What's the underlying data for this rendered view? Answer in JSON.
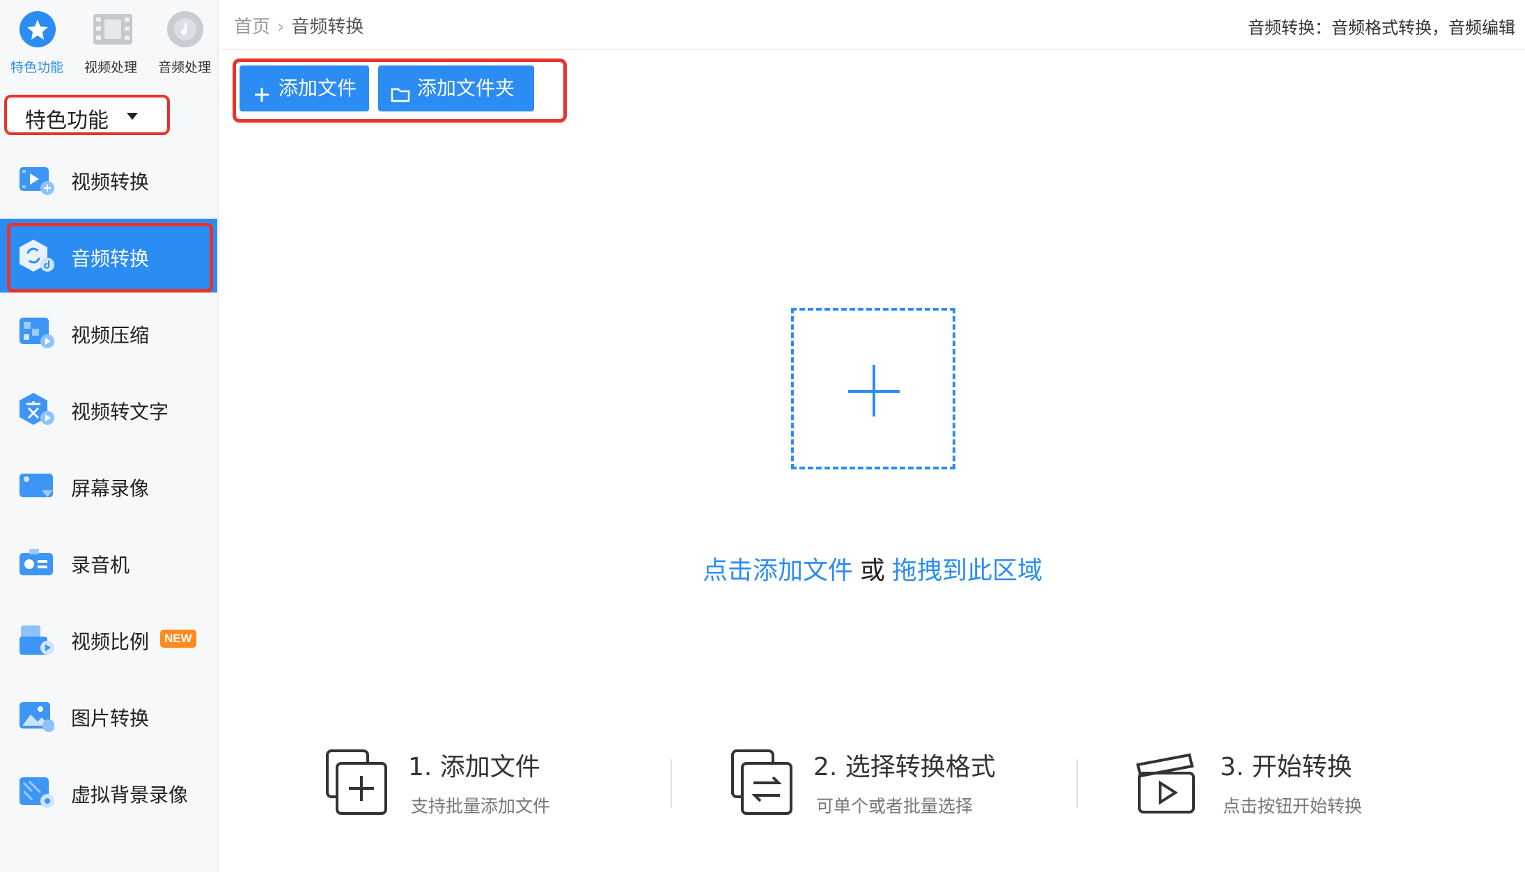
{
  "colors": {
    "accent": "#2b8cf3",
    "highlight_frame": "#e8332d",
    "badge_new": "#ff8a1e"
  },
  "top_tabs": [
    {
      "label": "特色功能",
      "icon": "star-icon"
    },
    {
      "label": "视频处理",
      "icon": "film-icon"
    },
    {
      "label": "音频处理",
      "icon": "music-disc-icon"
    }
  ],
  "category": {
    "label": "特色功能"
  },
  "menu": [
    {
      "label": "视频转换",
      "icon": "video-convert-icon"
    },
    {
      "label": "音频转换",
      "icon": "audio-convert-icon",
      "active": true
    },
    {
      "label": "视频压缩",
      "icon": "video-compress-icon"
    },
    {
      "label": "视频转文字",
      "icon": "video-to-text-icon"
    },
    {
      "label": "屏幕录像",
      "icon": "screen-record-icon"
    },
    {
      "label": "录音机",
      "icon": "recorder-icon"
    },
    {
      "label": "视频比例",
      "icon": "video-ratio-icon",
      "badge": "NEW"
    },
    {
      "label": "图片转换",
      "icon": "image-convert-icon"
    },
    {
      "label": "虚拟背景录像",
      "icon": "virtual-background-icon"
    }
  ],
  "breadcrumb": {
    "home": "首页",
    "current": "音频转换"
  },
  "top_description": "音频转换：音频格式转换，音频编辑",
  "toolbar": {
    "add_file": "添加文件",
    "add_folder": "添加文件夹"
  },
  "drop": {
    "link1": "点击添加文件",
    "or": "或",
    "link2": "拖拽到此区域"
  },
  "steps": [
    {
      "title": "1. 添加文件",
      "subtitle": "支持批量添加文件",
      "icon": "add-file-icon"
    },
    {
      "title": "2. 选择转换格式",
      "subtitle": "可单个或者批量选择",
      "icon": "swap-format-icon"
    },
    {
      "title": "3. 开始转换",
      "subtitle": "点击按钮开始转换",
      "icon": "play-clapper-icon"
    }
  ]
}
